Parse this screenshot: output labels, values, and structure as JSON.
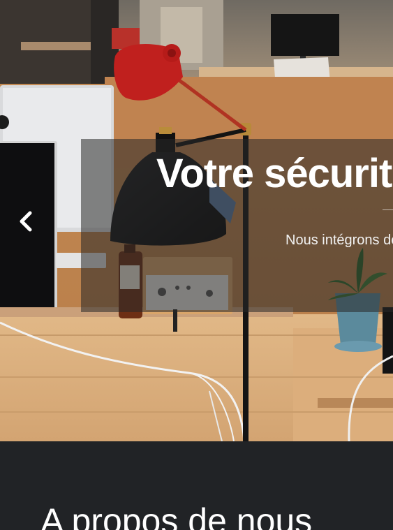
{
  "hero": {
    "title": "Votre sécurité",
    "subtitle": "Nous intégrons des solutions",
    "prev_icon": "chevron-left-icon"
  },
  "about": {
    "title": "A propos de nous"
  },
  "colors": {
    "overlay": "#282828",
    "section_dark": "#212326",
    "lamp_red": "#c0201e",
    "text_white": "#ffffff"
  }
}
